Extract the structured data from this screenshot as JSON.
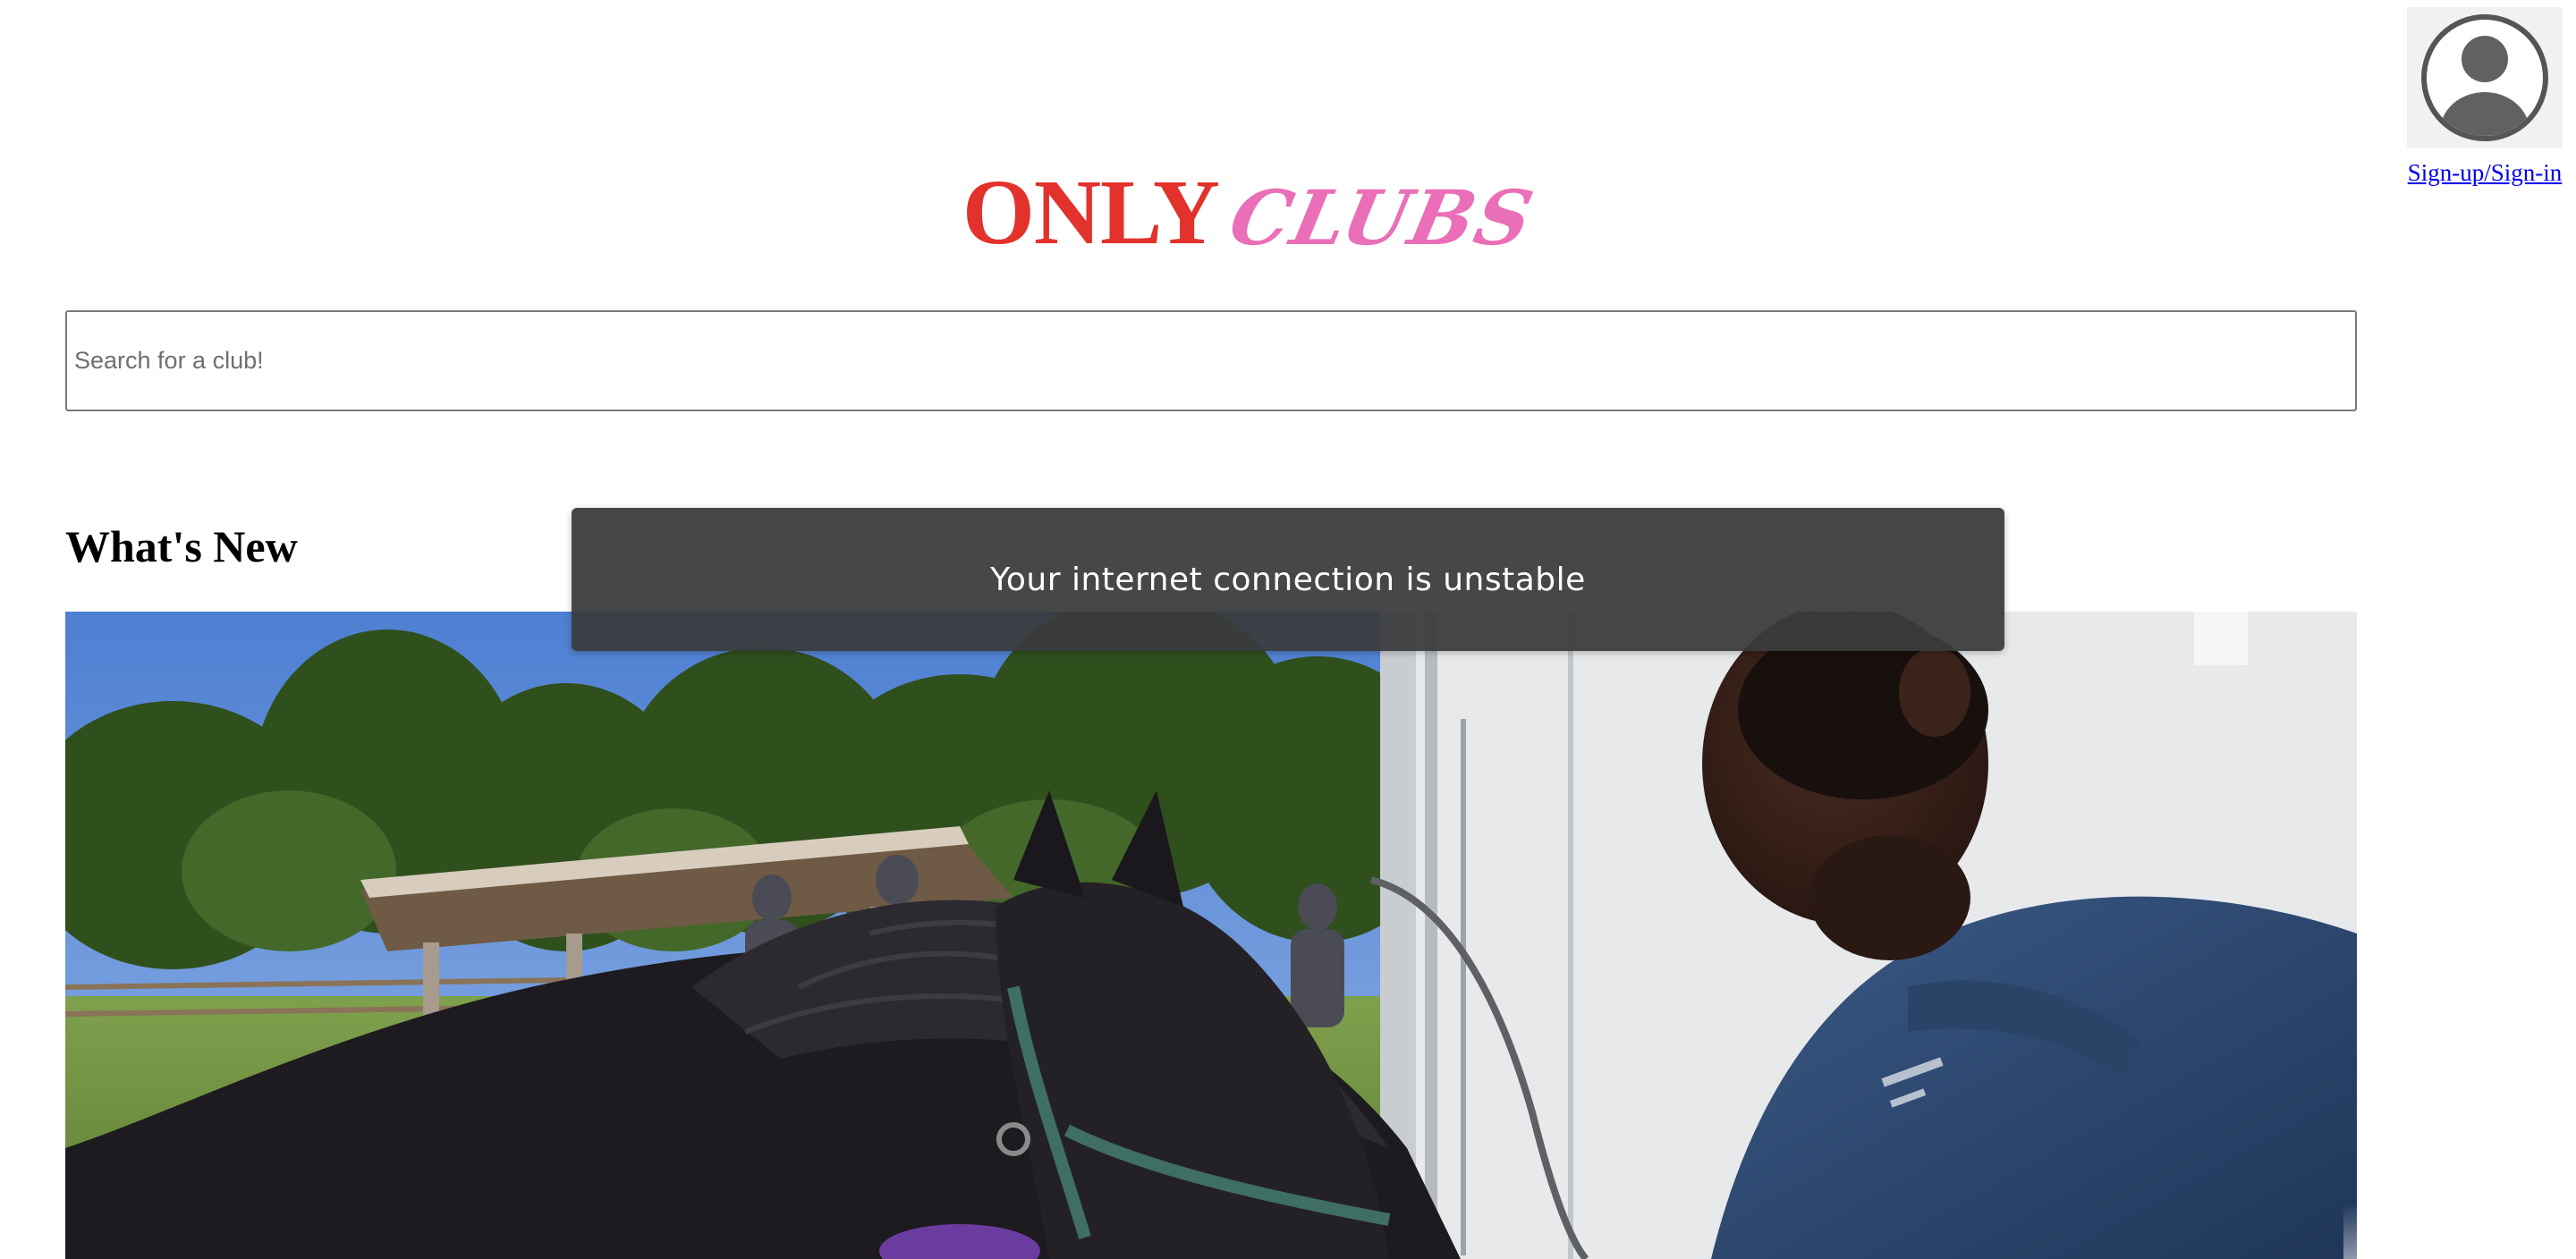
{
  "header": {
    "logo_part1": "ONLY",
    "logo_part2": "CLUBS",
    "logo_color_1": "#e3312b",
    "logo_color_2": "#ea6fb8"
  },
  "account": {
    "avatar_icon": "user-avatar-icon",
    "link_label": "Sign-up/Sign-in"
  },
  "search": {
    "placeholder": "Search for a club!",
    "value": ""
  },
  "main": {
    "section_title": "What's New",
    "featured_image_alt": "Student with a pony at a club event"
  },
  "toast": {
    "message": "Your internet connection is unstable"
  }
}
